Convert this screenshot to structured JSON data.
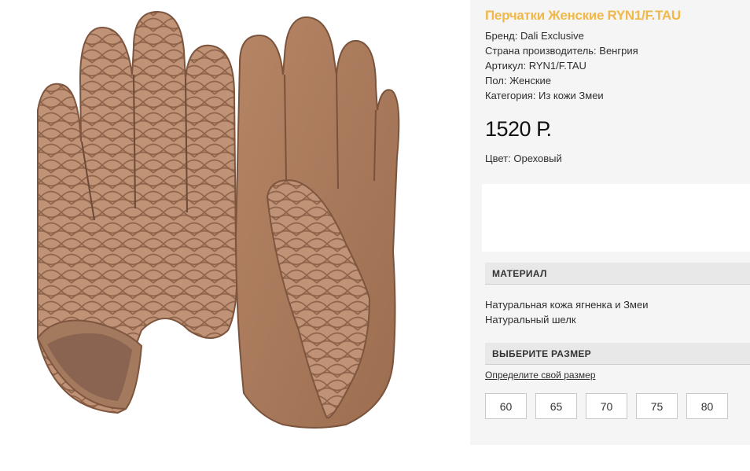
{
  "product": {
    "title": "Перчатки Женские RYN1/F.TAU",
    "attributes": [
      "Бренд: Dali Exclusive",
      "Страна производитель: Венгрия",
      "Артикул: RYN1/F.TAU",
      "Пол: Женские",
      "Категория: Из кожи Змеи"
    ],
    "price": "1520 Р.",
    "color_line": "Цвет: Ореховый"
  },
  "material": {
    "heading": "МАТЕРИАЛ",
    "items": [
      "Натуральная кожа ягненка и Змеи",
      "Натуральный шелк"
    ]
  },
  "size": {
    "heading": "ВЫБЕРИТЕ РАЗМЕР",
    "link": "Определите свой размер",
    "options": [
      "60",
      "65",
      "70",
      "75",
      "80"
    ]
  },
  "colors": {
    "title_accent": "#f0b848",
    "panel_bg": "#f5f5f5",
    "section_bg": "#e8e8e8",
    "leather": "#a9795a",
    "snakeskin": "#c2967a"
  }
}
